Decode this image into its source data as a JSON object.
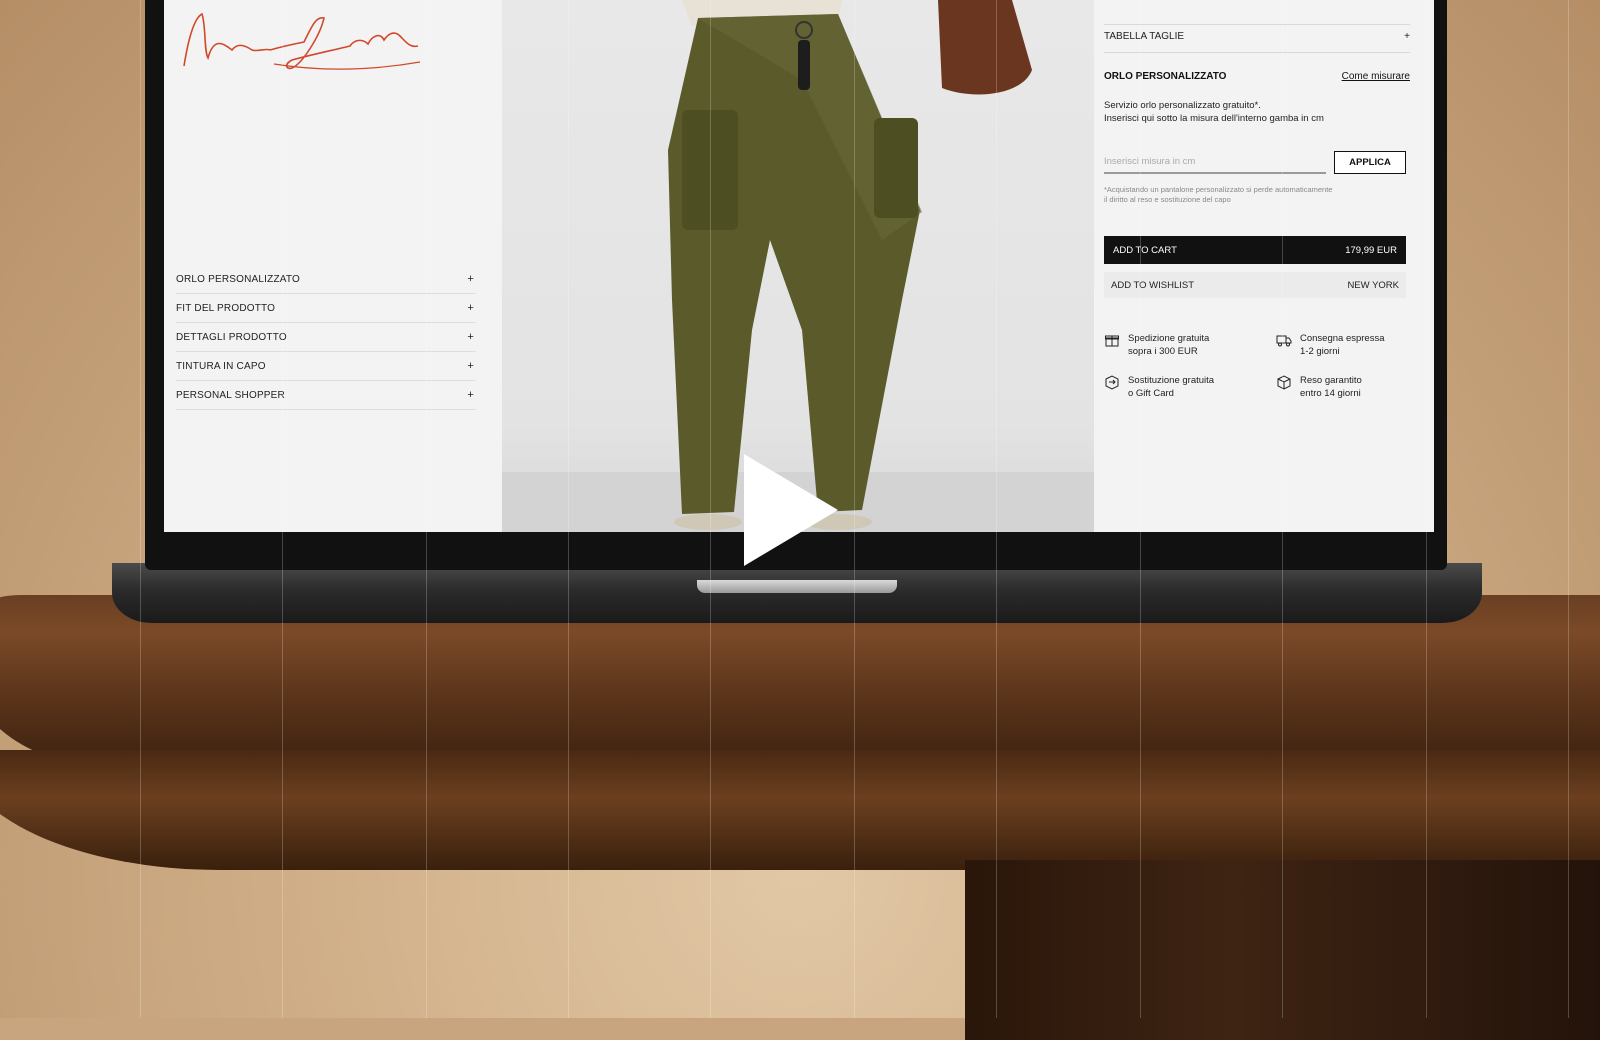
{
  "signature": {
    "text": "New York"
  },
  "left_menu": {
    "items": [
      {
        "label": "ORLO PERSONALIZZATO",
        "icon": "+"
      },
      {
        "label": "FIT DEL PRODOTTO",
        "icon": "+"
      },
      {
        "label": "DETTAGLI PRODOTTO",
        "icon": "+"
      },
      {
        "label": "TINTURA IN CAPO",
        "icon": "+"
      },
      {
        "label": "PERSONAL SHOPPER",
        "icon": "+"
      }
    ]
  },
  "right_panel": {
    "size_chart": {
      "label": "TABELLA TAGLIE",
      "icon": "+"
    },
    "hem": {
      "title": "ORLO PERSONALIZZATO",
      "link": "Come misurare",
      "desc_line1": "Servizio orlo personalizzato gratuito*.",
      "desc_line2": "Inserisci qui sotto la misura dell'interno gamba in cm",
      "input_placeholder": "Inserisci misura in cm",
      "apply_label": "APPLICA",
      "note_line1": "*Acquistando un pantalone personalizzato si perde automaticamente",
      "note_line2": "il diritto al reso e sostituzione del capo"
    },
    "cart": {
      "label": "ADD TO CART",
      "price": "179,99 EUR"
    },
    "wishlist": {
      "label": "ADD TO WISHLIST",
      "collection": "NEW YORK"
    },
    "features": [
      {
        "icon": "gift-icon",
        "line1": "Spedizione gratuita",
        "line2": "sopra i 300 EUR"
      },
      {
        "icon": "truck-icon",
        "line1": "Consegna espressa",
        "line2": "1-2 giorni"
      },
      {
        "icon": "exchange-box-icon",
        "line1": "Sostituzione gratuita",
        "line2": "o Gift Card"
      },
      {
        "icon": "return-box-icon",
        "line1": "Reso garantito",
        "line2": "entro 14 giorni"
      }
    ]
  },
  "video": {
    "play_icon": "play-icon"
  }
}
